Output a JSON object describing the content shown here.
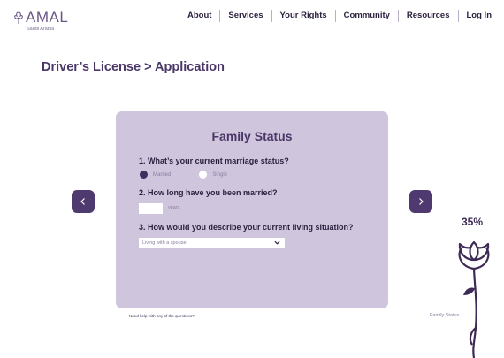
{
  "brand": {
    "name": "AMAL",
    "subtitle": "Saudi Arabia",
    "icon": "rose-icon"
  },
  "nav": [
    "About",
    "Services",
    "Your Rights",
    "Community",
    "Resources",
    "Log In"
  ],
  "breadcrumb": "Driver’s License > Application",
  "form": {
    "title": "Family Status",
    "q1": {
      "label": "1. What’s your current marriage status?",
      "options": [
        "Married",
        "Single"
      ],
      "selected": "Married"
    },
    "q2": {
      "label": "2. How long have you been married?",
      "value": "",
      "unit": "years"
    },
    "q3": {
      "label": "3. How would you describe your current living situation?",
      "selected": "Living with a spouse"
    }
  },
  "help_text": "Need help with any of the questions?",
  "progress": {
    "percent_label": "35%",
    "value": 0.35,
    "step_label": "Family Status"
  },
  "colors": {
    "accent": "#4e3a6e",
    "card": "#cfc5dd",
    "text": "#3d2b56"
  }
}
